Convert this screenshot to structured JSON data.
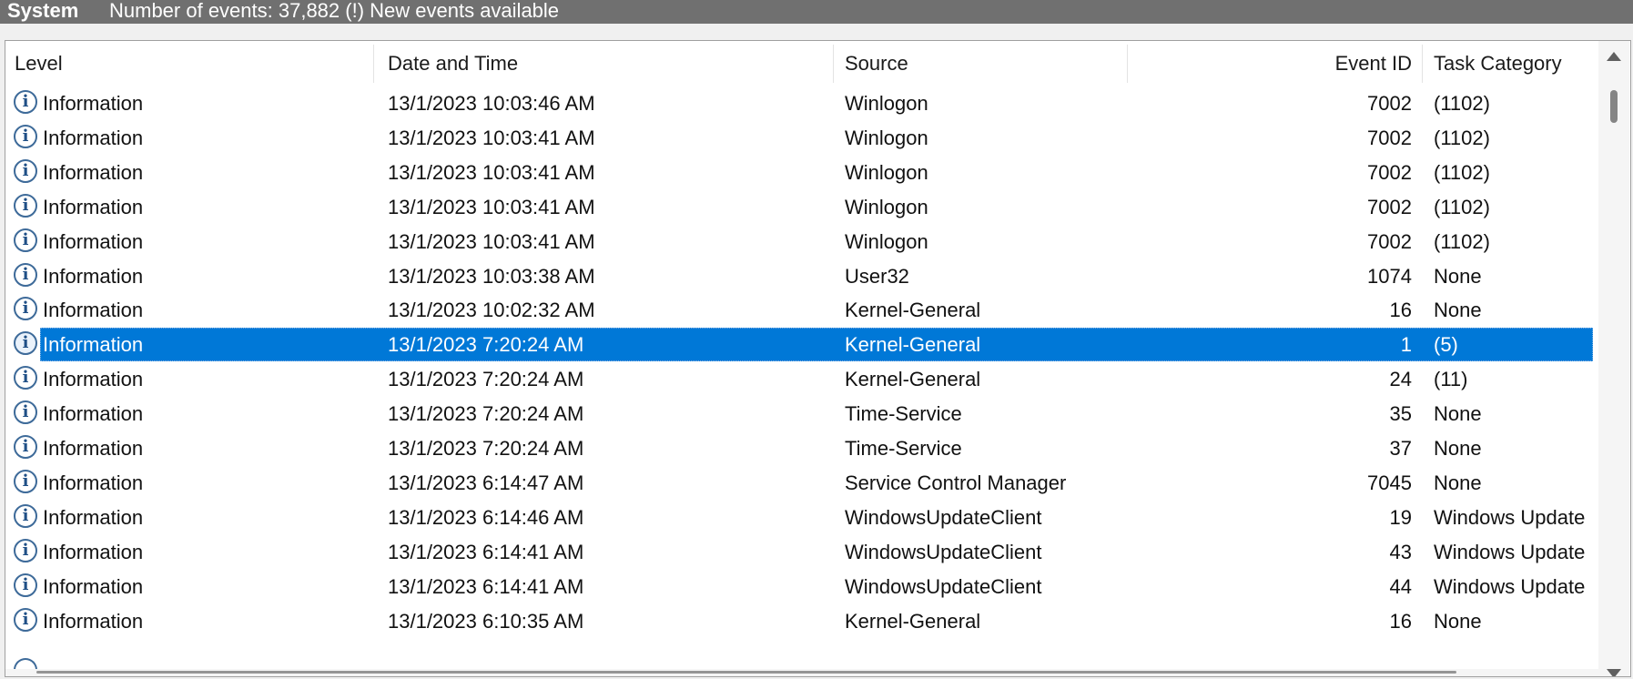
{
  "titlebar": {
    "log_name": "System",
    "event_count": "Number of events: 37,882 (!) New events available"
  },
  "columns": {
    "level": "Level",
    "date_time": "Date and Time",
    "source": "Source",
    "event_id": "Event ID",
    "task_category": "Task Category"
  },
  "level_icon": "information-icon",
  "rows": [
    {
      "level": "Information",
      "date_time": "13/1/2023 10:03:46 AM",
      "source": "Winlogon",
      "event_id": "7002",
      "task_category": "(1102)"
    },
    {
      "level": "Information",
      "date_time": "13/1/2023 10:03:41 AM",
      "source": "Winlogon",
      "event_id": "7002",
      "task_category": "(1102)"
    },
    {
      "level": "Information",
      "date_time": "13/1/2023 10:03:41 AM",
      "source": "Winlogon",
      "event_id": "7002",
      "task_category": "(1102)"
    },
    {
      "level": "Information",
      "date_time": "13/1/2023 10:03:41 AM",
      "source": "Winlogon",
      "event_id": "7002",
      "task_category": "(1102)"
    },
    {
      "level": "Information",
      "date_time": "13/1/2023 10:03:41 AM",
      "source": "Winlogon",
      "event_id": "7002",
      "task_category": "(1102)"
    },
    {
      "level": "Information",
      "date_time": "13/1/2023 10:03:38 AM",
      "source": "User32",
      "event_id": "1074",
      "task_category": "None"
    },
    {
      "level": "Information",
      "date_time": "13/1/2023 10:02:32 AM",
      "source": "Kernel-General",
      "event_id": "16",
      "task_category": "None"
    },
    {
      "level": "Information",
      "date_time": "13/1/2023 7:20:24 AM",
      "source": "Kernel-General",
      "event_id": "1",
      "task_category": "(5)",
      "selected": true
    },
    {
      "level": "Information",
      "date_time": "13/1/2023 7:20:24 AM",
      "source": "Kernel-General",
      "event_id": "24",
      "task_category": "(11)"
    },
    {
      "level": "Information",
      "date_time": "13/1/2023 7:20:24 AM",
      "source": "Time-Service",
      "event_id": "35",
      "task_category": "None"
    },
    {
      "level": "Information",
      "date_time": "13/1/2023 7:20:24 AM",
      "source": "Time-Service",
      "event_id": "37",
      "task_category": "None"
    },
    {
      "level": "Information",
      "date_time": "13/1/2023 6:14:47 AM",
      "source": "Service Control Manager",
      "event_id": "7045",
      "task_category": "None"
    },
    {
      "level": "Information",
      "date_time": "13/1/2023 6:14:46 AM",
      "source": "WindowsUpdateClient",
      "event_id": "19",
      "task_category": "Windows Update"
    },
    {
      "level": "Information",
      "date_time": "13/1/2023 6:14:41 AM",
      "source": "WindowsUpdateClient",
      "event_id": "43",
      "task_category": "Windows Update"
    },
    {
      "level": "Information",
      "date_time": "13/1/2023 6:14:41 AM",
      "source": "WindowsUpdateClient",
      "event_id": "44",
      "task_category": "Windows Update"
    },
    {
      "level": "Information",
      "date_time": "13/1/2023 6:10:35 AM",
      "source": "Kernel-General",
      "event_id": "16",
      "task_category": "None"
    }
  ],
  "colors": {
    "selection": "#0078d7",
    "titlebar": "#707070",
    "icon_blue": "#1f4f86"
  }
}
